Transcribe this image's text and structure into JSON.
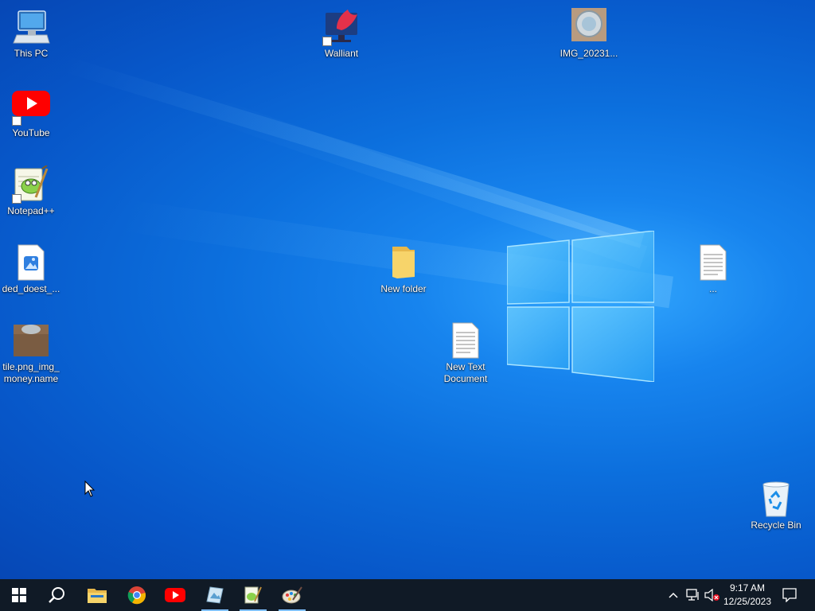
{
  "desktop_icons": {
    "this_pc": "This PC",
    "youtube": "YouTube",
    "notepadpp": "Notepad++",
    "ded_doest": "ded_doest_...",
    "tile_png": "tile.png_img_money.name",
    "walliant": "Walliant",
    "img_2023": "IMG_20231...",
    "new_folder": "New folder",
    "new_text_document": "New Text Document",
    "unnamed_file": "...",
    "recycle_bin": "Recycle Bin"
  },
  "taskbar": {
    "items": [
      {
        "icon": "windows-start-icon"
      },
      {
        "icon": "search-icon"
      },
      {
        "icon": "file-explorer-icon"
      },
      {
        "icon": "chrome-icon"
      },
      {
        "icon": "youtube-icon"
      },
      {
        "icon": "image-viewer-icon",
        "active": true
      },
      {
        "icon": "notepadpp-icon",
        "active": true
      },
      {
        "icon": "paint-icon",
        "active": true
      }
    ],
    "tray": {
      "icons": [
        "chevron-up-icon",
        "network-icon",
        "volume-muted-icon",
        "notification-icon"
      ],
      "time": "9:17 AM",
      "date": "12/25/2023"
    }
  },
  "colors": {
    "taskbar_bg": "#101a26",
    "desktop_accent": "#0c6fdd",
    "active_indicator": "#7fbfff"
  }
}
